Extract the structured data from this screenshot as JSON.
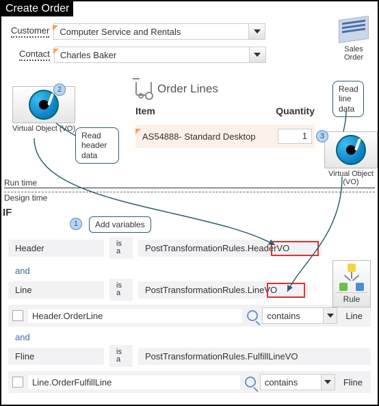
{
  "title": "Create Order",
  "form": {
    "customer_label": "Customer",
    "customer_value": "Computer Service and Rentals",
    "contact_label": "Contact",
    "contact_value": "Charles Baker"
  },
  "sales_order_icon_label": "Sales Order",
  "vo_label": "Virtual Object (VO)",
  "callouts": {
    "read_header": "Read header data",
    "read_line": "Read line data",
    "add_vars": "Add variables"
  },
  "steps": {
    "s1": "1",
    "s2": "2",
    "s3": "3"
  },
  "order_lines": {
    "heading": "Order Lines",
    "col_item": "Item",
    "col_qty": "Quantity",
    "item_name": "AS54888- Standard Desktop",
    "qty": "1"
  },
  "dividers": {
    "runtime": "Run time",
    "designtime": "Design time"
  },
  "if_label": "IF",
  "rules": {
    "and": "and",
    "isa": "is a",
    "contains": "contains",
    "header_var": "Header",
    "header_type": "PostTransformationRules.HeaderVO",
    "line_var": "Line",
    "line_type": "PostTransformationRules.LineVO",
    "fline_var": "Fline",
    "fline_type": "PostTransformationRules.FulfillLineVO",
    "cond1_lhs": "Header.OrderLine",
    "cond1_rhs": "Line",
    "cond2_lhs": "Line.OrderFulfillLine",
    "cond2_rhs": "Fline"
  },
  "rule_icon_label": "Rule"
}
